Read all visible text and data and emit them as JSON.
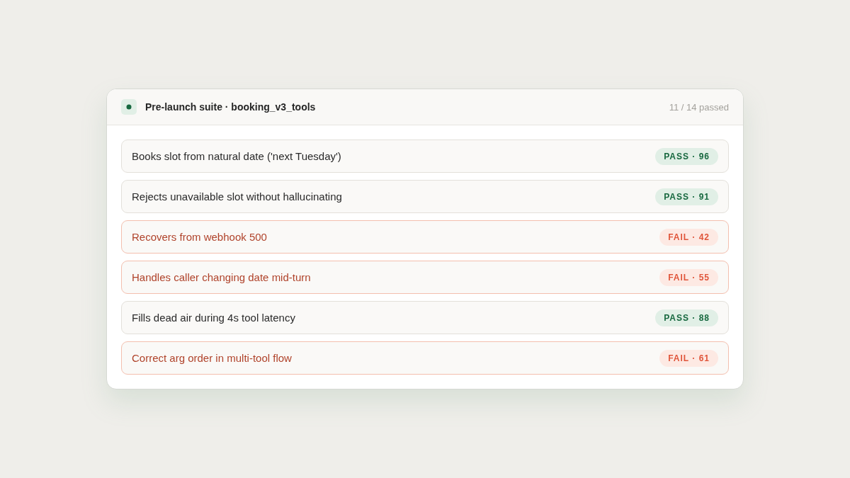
{
  "suite": {
    "title": "Pre-launch suite · booking_v3_tools",
    "summary": "11 / 14 passed"
  },
  "tests": [
    {
      "name": "Books slot from natural date ('next Tuesday')",
      "kind": "pass",
      "badge": "PASS · 96"
    },
    {
      "name": "Rejects unavailable slot without hallucinating",
      "kind": "pass",
      "badge": "PASS · 91"
    },
    {
      "name": "Recovers from webhook 500",
      "kind": "fail",
      "badge": "FAIL · 42"
    },
    {
      "name": "Handles caller changing date mid-turn",
      "kind": "fail",
      "badge": "FAIL · 55"
    },
    {
      "name": "Fills dead air during 4s tool latency",
      "kind": "pass",
      "badge": "PASS · 88"
    },
    {
      "name": "Correct arg order in multi-tool flow",
      "kind": "fail",
      "badge": "FAIL · 61"
    }
  ]
}
